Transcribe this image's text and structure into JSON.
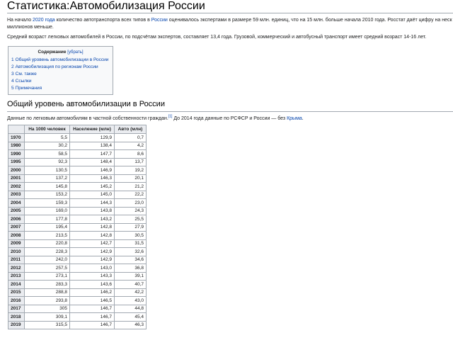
{
  "page": {
    "title": "Статистика:Автомобилизация России",
    "intro": {
      "a": "На начало ",
      "link1": "2020 года",
      "b": " количество автотранспорта всех типов в ",
      "link2": "России",
      "c": " оценивалось экспертами в размере 59 млн. единиц, что на 15 млн. больше начала 2010 года. Росстат даёт цифру на неск",
      "d": "миллионов меньше."
    },
    "avg_age": "Средний возраст легковых автомобилей в России, по подсчётам экспертов, составляет 13,4 года. Грузовой, коммерческий и автобусный транспорт имеет средний возраст 14-16 лет."
  },
  "toc": {
    "title": "Содержание",
    "hide": "[убрать]",
    "items": [
      {
        "num": "1",
        "label": "Общий уровень автомобилизации в России"
      },
      {
        "num": "2",
        "label": "Автомобилизация по регионам России"
      },
      {
        "num": "3",
        "label": "См. также"
      },
      {
        "num": "4",
        "label": "Ссылки"
      },
      {
        "num": "5",
        "label": "Примечания"
      }
    ]
  },
  "section": {
    "heading": "Общий уровень автомобилизации в России",
    "note_a": "Данные по легковым автомобилям в частной собственности граждан.",
    "note_ref": "[1]",
    "note_b": " До 2014 года данные по РСФСР и России — без ",
    "note_link": "Крыма",
    "note_end": "."
  },
  "table": {
    "headers": [
      "",
      "На 1000 человек",
      "Население (млн)",
      "Авто (млн)"
    ],
    "rows": [
      [
        "1970",
        "5,5",
        "129,9",
        "0,7"
      ],
      [
        "1980",
        "30,2",
        "138,4",
        "4,2"
      ],
      [
        "1990",
        "58,5",
        "147,7",
        "8,6"
      ],
      [
        "1995",
        "92,3",
        "148,4",
        "13,7"
      ],
      [
        "2000",
        "130,5",
        "146,9",
        "19,2"
      ],
      [
        "2001",
        "137,2",
        "146,3",
        "20,1"
      ],
      [
        "2002",
        "145,8",
        "145,2",
        "21,2"
      ],
      [
        "2003",
        "153,2",
        "145,0",
        "22,2"
      ],
      [
        "2004",
        "159,3",
        "144,3",
        "23,0"
      ],
      [
        "2005",
        "169,0",
        "143,8",
        "24,3"
      ],
      [
        "2006",
        "177,8",
        "143,2",
        "25,5"
      ],
      [
        "2007",
        "195,4",
        "142,8",
        "27,9"
      ],
      [
        "2008",
        "213,5",
        "142,8",
        "30,5"
      ],
      [
        "2009",
        "220,8",
        "142,7",
        "31,5"
      ],
      [
        "2010",
        "228,3",
        "142,9",
        "32,6"
      ],
      [
        "2011",
        "242,0",
        "142,9",
        "34,6"
      ],
      [
        "2012",
        "257,5",
        "143,0",
        "36,8"
      ],
      [
        "2013",
        "273,1",
        "143,3",
        "39,1"
      ],
      [
        "2014",
        "283,3",
        "143,6",
        "40,7"
      ],
      [
        "2015",
        "288,8",
        "146,2",
        "42,2"
      ],
      [
        "2016",
        "293,8",
        "146,5",
        "43,0"
      ],
      [
        "2017",
        "305",
        "146,7",
        "44,8"
      ],
      [
        "2018",
        "309,1",
        "146,7",
        "45,4"
      ],
      [
        "2019",
        "315,5",
        "146,7",
        "46,3"
      ]
    ]
  }
}
